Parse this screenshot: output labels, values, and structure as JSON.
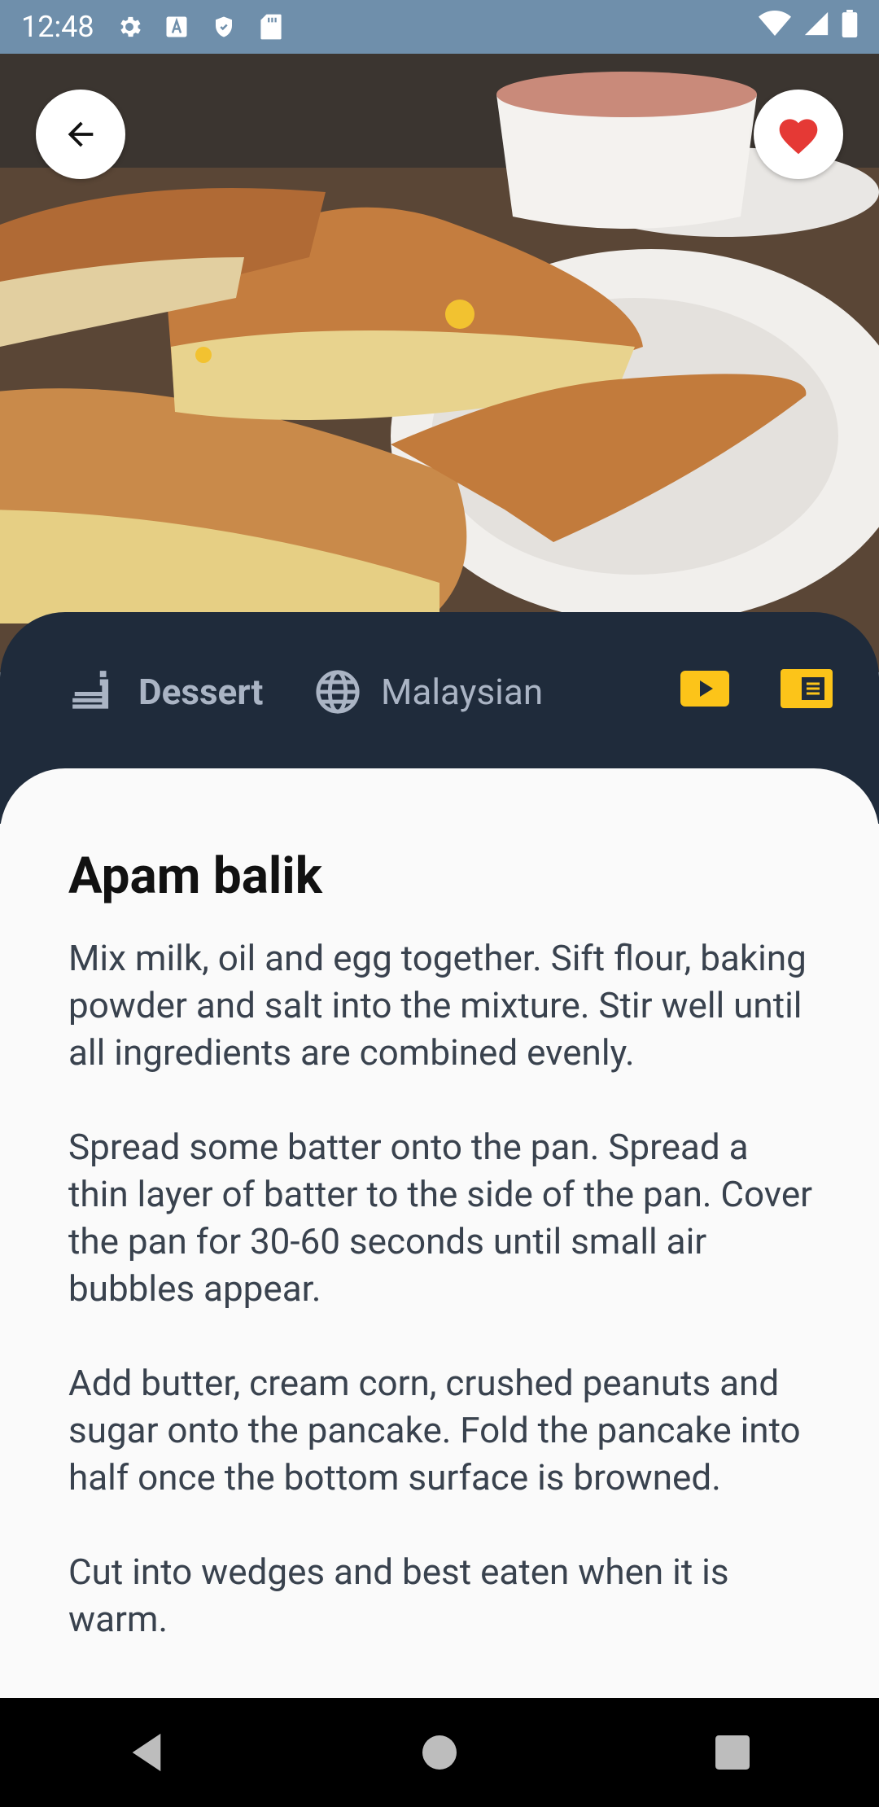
{
  "status_bar": {
    "time": "12:48",
    "left_icons": [
      "settings-icon",
      "font-icon",
      "shield-icon",
      "sd-card-icon"
    ],
    "right_icons": [
      "wifi-icon",
      "signal-icon",
      "battery-icon"
    ]
  },
  "hero": {
    "image_subject": "Apam balik pancakes on a plate with a tea cup"
  },
  "meta": {
    "category_label": "Dessert",
    "area_label": "Malaysian",
    "accent_color": "#fcc419",
    "panel_color": "#1f2b3b"
  },
  "recipe": {
    "title": "Apam balik",
    "paragraphs": [
      "Mix milk, oil and egg together. Sift flour, baking powder and salt into the mixture. Stir well until all ingredients are combined evenly.",
      "Spread some batter onto the pan. Spread a thin layer of batter to the side of the pan. Cover the pan for 30-60 seconds until small air bubbles appear.",
      "Add butter, cream corn, crushed peanuts and sugar onto the pancake. Fold the pancake into half once the bottom surface is browned.",
      "Cut into wedges and best eaten when it is warm."
    ]
  },
  "favorite_color": "#e53935"
}
